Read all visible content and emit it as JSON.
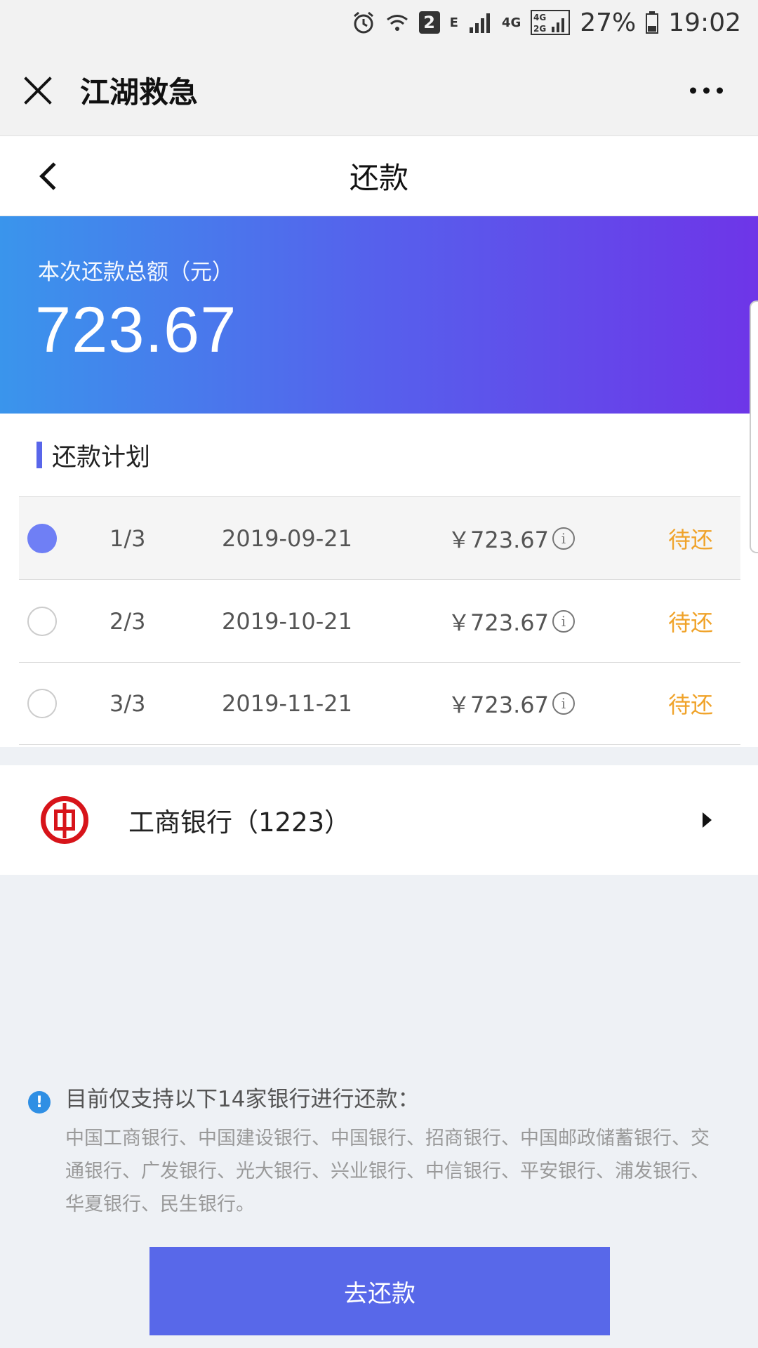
{
  "status_bar": {
    "sim_badge": "2",
    "network_e": "E",
    "network_4g": "4G",
    "network_4g2g": "4G 2G",
    "battery": "27%",
    "time": "19:02"
  },
  "mini_program": {
    "title": "江湖救急"
  },
  "nav": {
    "title": "还款"
  },
  "summary": {
    "label": "本次还款总额（元）",
    "amount": "723.67"
  },
  "plan": {
    "title": "还款计划",
    "rows": [
      {
        "period": "1/3",
        "date": "2019-09-21",
        "amount": "￥723.67",
        "status": "待还",
        "selected": true
      },
      {
        "period": "2/3",
        "date": "2019-10-21",
        "amount": "￥723.67",
        "status": "待还",
        "selected": false
      },
      {
        "period": "3/3",
        "date": "2019-11-21",
        "amount": "￥723.67",
        "status": "待还",
        "selected": false
      }
    ]
  },
  "bank": {
    "name": "工商银行（1223）"
  },
  "notice": {
    "icon_glyph": "!",
    "title": "目前仅支持以下14家银行进行还款：",
    "text": "中国工商银行、中国建设银行、中国银行、招商银行、中国邮政储蓄银行、交通银行、广发银行、光大银行、兴业银行、中信银行、平安银行、浦发银行、华夏银行、民生银行。"
  },
  "button": {
    "label": "去还款"
  },
  "colors": {
    "accent": "#5868e9",
    "pending": "#f0a32a",
    "bank_red": "#d7141a"
  }
}
